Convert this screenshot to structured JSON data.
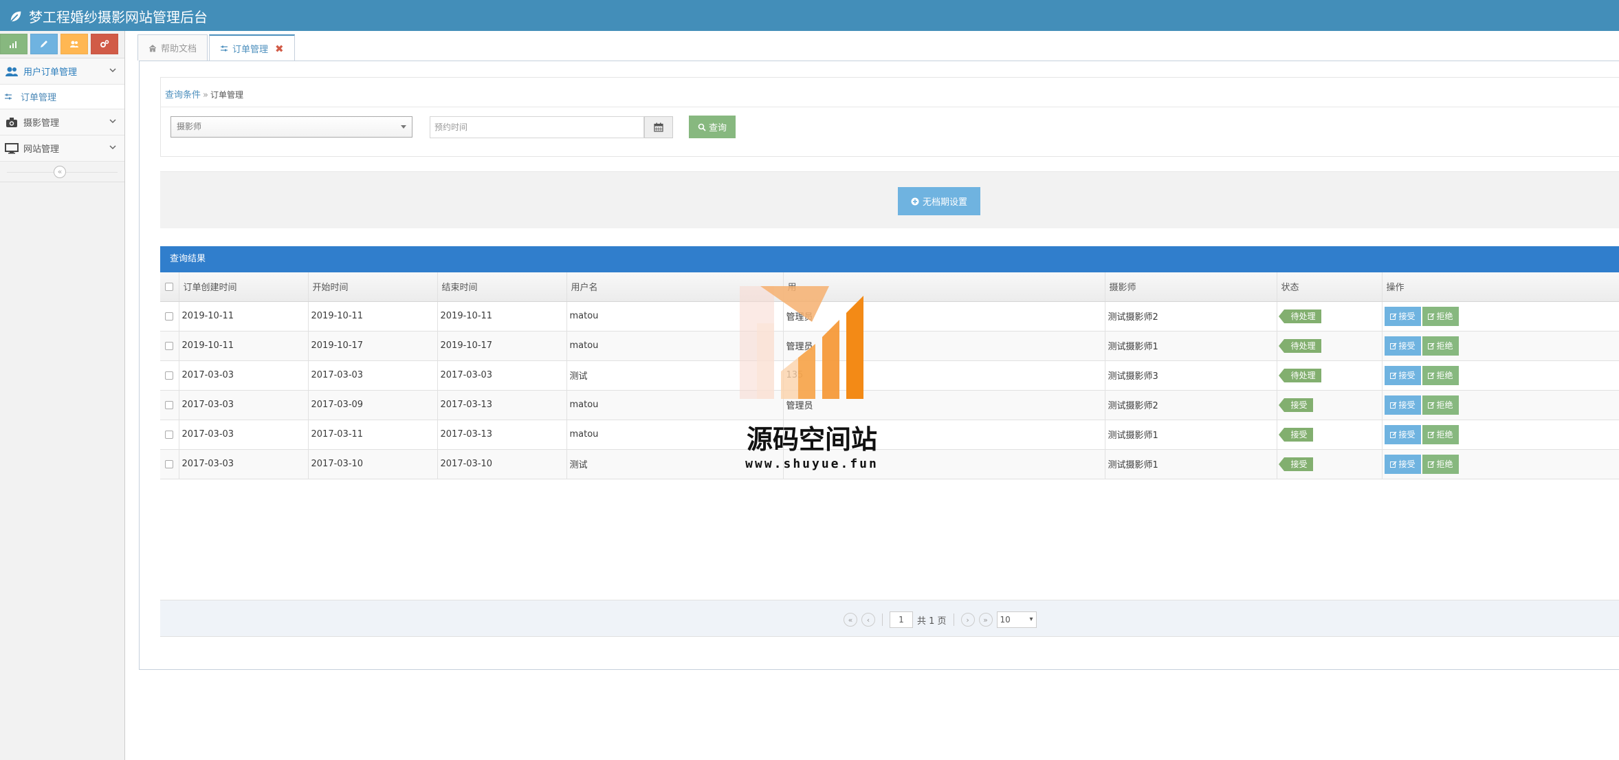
{
  "app": {
    "title": "梦工程婚纱摄影网站管理后台"
  },
  "sidebar": {
    "shortcuts": [
      {
        "name": "signal-icon",
        "color": "#87b87f"
      },
      {
        "name": "pencil-icon",
        "color": "#6fb3e0"
      },
      {
        "name": "users-icon",
        "color": "#ffb752"
      },
      {
        "name": "cogs-icon",
        "color": "#d15b47"
      }
    ],
    "menu": [
      {
        "label": "用户订单管理",
        "icon": "users-icon",
        "open": true,
        "children": [
          {
            "label": "订单管理",
            "icon": "sliders-icon"
          }
        ]
      },
      {
        "label": "摄影管理",
        "icon": "camera-icon"
      },
      {
        "label": "网站管理",
        "icon": "desktop-icon"
      }
    ],
    "collapse_glyph": "«"
  },
  "tabs": [
    {
      "label": "帮助文档",
      "icon": "home-icon",
      "active": false
    },
    {
      "label": "订单管理",
      "icon": "sliders-icon",
      "active": true,
      "close": "✖"
    }
  ],
  "query": {
    "breadcrumb": {
      "root": "查询条件",
      "sep": "»",
      "current": "订单管理"
    },
    "photographer_placeholder": "摄影师",
    "date_placeholder": "预约时间",
    "search_label": "查询"
  },
  "toolbar": {
    "schedule_label": "无档期设置"
  },
  "grid": {
    "title": "查询结果",
    "columns": [
      "订单创建时间",
      "开始时间",
      "结束时间",
      "用户名",
      "用",
      "摄影师",
      "状态",
      "操作"
    ],
    "rows": [
      {
        "created": "2019-10-11",
        "start": "2019-10-11",
        "end": "2019-10-11",
        "user": "matou",
        "col5": "管理员",
        "photographer": "测试摄影师2",
        "status": "待处理"
      },
      {
        "created": "2019-10-11",
        "start": "2019-10-17",
        "end": "2019-10-17",
        "user": "matou",
        "col5": "管理员",
        "photographer": "测试摄影师1",
        "status": "待处理"
      },
      {
        "created": "2017-03-03",
        "start": "2017-03-03",
        "end": "2017-03-03",
        "user": "测试",
        "col5": "135",
        "photographer": "测试摄影师3",
        "status": "待处理"
      },
      {
        "created": "2017-03-03",
        "start": "2017-03-09",
        "end": "2017-03-13",
        "user": "matou",
        "col5": "管理员",
        "photographer": "测试摄影师2",
        "status": "接受"
      },
      {
        "created": "2017-03-03",
        "start": "2017-03-11",
        "end": "2017-03-13",
        "user": "matou",
        "col5": "",
        "photographer": "测试摄影师1",
        "status": "接受"
      },
      {
        "created": "2017-03-03",
        "start": "2017-03-10",
        "end": "2017-03-10",
        "user": "测试",
        "col5": "",
        "photographer": "测试摄影师1",
        "status": "接受"
      }
    ],
    "actions": {
      "accept": "接受",
      "reject": "拒绝"
    }
  },
  "pager": {
    "current_page": "1",
    "total_text": "共 1 页",
    "rows_per_page": "10"
  },
  "watermark": {
    "text": "源码空间站",
    "url": "www.shuyue.fun"
  },
  "colors": {
    "navbar": "#438eb9",
    "grid_header": "#307ecc",
    "accent_blue": "#6fb3e0",
    "accent_green": "#87b87f",
    "status_green": "#82af6f"
  }
}
